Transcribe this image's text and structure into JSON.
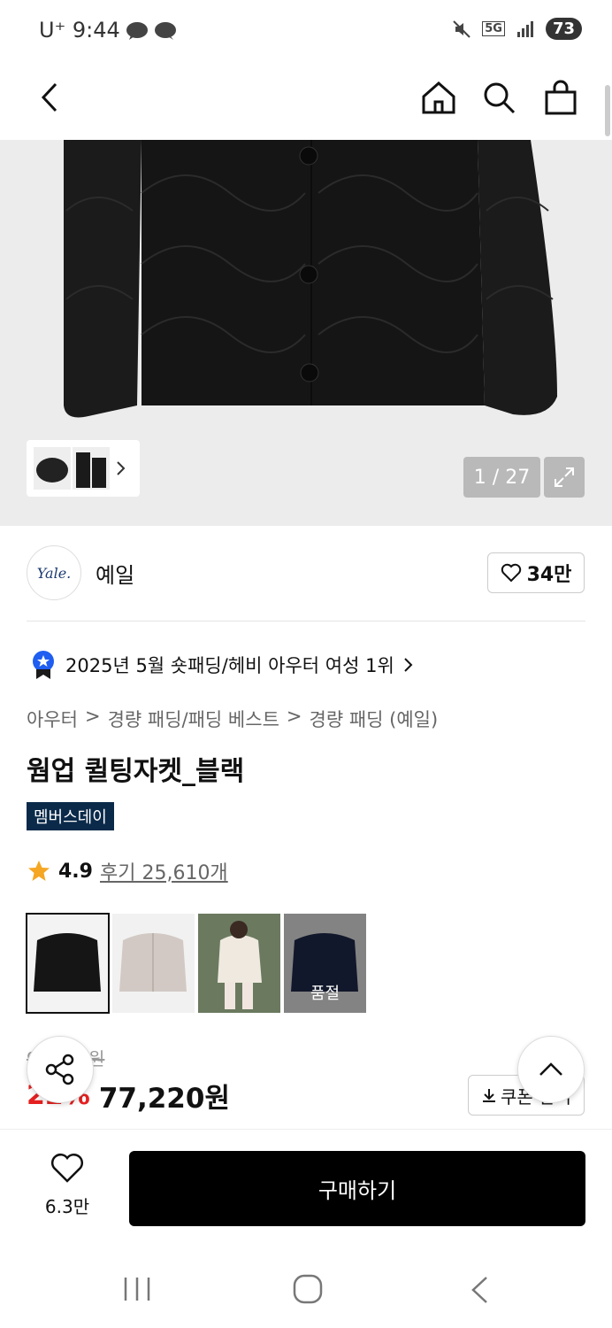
{
  "status_bar": {
    "time": "U⁺ 9:44",
    "network": "5G",
    "battery": "73"
  },
  "product": {
    "image_counter": "1 / 27",
    "brand_logo_text": "Yale.",
    "brand_name": "예일",
    "brand_likes": "34만",
    "ranking_text": "2025년 5월 숏패딩/헤비 아우터 여성 1위",
    "breadcrumb": [
      "아우터",
      ">",
      "경량 패딩/패딩 베스트",
      ">",
      "경량 패딩 (예일)"
    ],
    "title": "웜업 퀼팅자켓_블랙",
    "tag": "멤버스데이",
    "rating": "4.9",
    "reviews": "후기 25,610개",
    "variants": [
      {
        "label": "",
        "selected": true
      },
      {
        "label": ""
      },
      {
        "label": ""
      },
      {
        "label": "품절"
      }
    ],
    "original_price": "99,000원",
    "discount": "22%",
    "price": "77,220원",
    "coupon_label": "쿠폰 받기"
  },
  "bottom_bar": {
    "wish_count": "6.3만",
    "buy_label": "구매하기"
  },
  "colors": {
    "buy_button": "#000000",
    "discount": "#e52020",
    "tag_bg": "#0b2a4a",
    "star": "#f5a623"
  }
}
